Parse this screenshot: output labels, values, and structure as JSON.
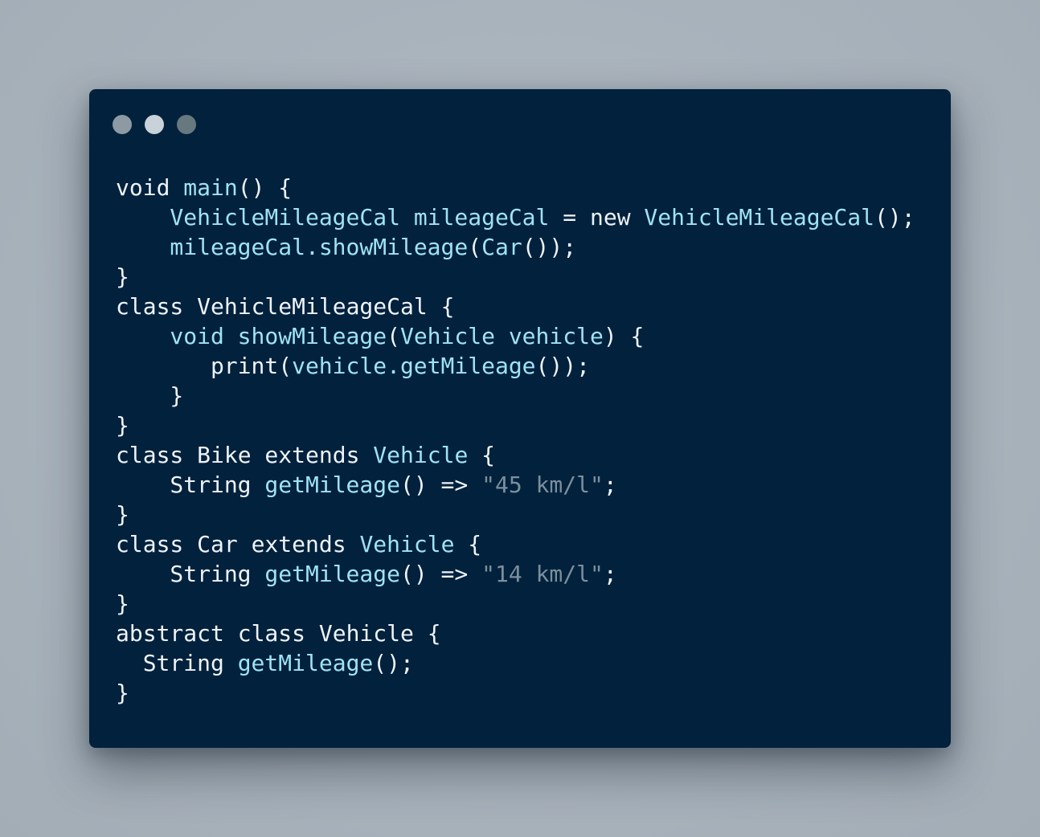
{
  "window": {
    "control_colors": [
      "#8d9aa3",
      "#c9d2d8",
      "#67787f"
    ],
    "control_icons": [
      "window-dot-icon",
      "window-dot-icon",
      "window-dot-icon"
    ]
  },
  "code": {
    "colors": {
      "background": "#01213d",
      "default": "#eef3f7",
      "ident": "#9fe3f4",
      "string": "#7b8f9c"
    },
    "lines": [
      {
        "indent": "",
        "tokens": [
          [
            "default",
            "void "
          ],
          [
            "ident",
            "main"
          ],
          [
            "default",
            "() {"
          ]
        ]
      },
      {
        "indent": "    ",
        "tokens": [
          [
            "ident",
            "VehicleMileageCal mileageCal"
          ],
          [
            "default",
            " = "
          ],
          [
            "default",
            "new "
          ],
          [
            "ident",
            "VehicleMileageCal"
          ],
          [
            "default",
            "();"
          ]
        ]
      },
      {
        "indent": "    ",
        "tokens": [
          [
            "ident",
            "mileageCal.showMileage"
          ],
          [
            "default",
            "("
          ],
          [
            "ident",
            "Car"
          ],
          [
            "default",
            "());"
          ]
        ]
      },
      {
        "indent": "",
        "tokens": [
          [
            "default",
            "}"
          ]
        ]
      },
      {
        "indent": "",
        "tokens": [
          [
            "default",
            "class VehicleMileageCal {"
          ]
        ]
      },
      {
        "indent": "    ",
        "tokens": [
          [
            "ident",
            "void showMileage"
          ],
          [
            "default",
            "("
          ],
          [
            "ident",
            "Vehicle vehicle"
          ],
          [
            "default",
            ") {"
          ]
        ]
      },
      {
        "indent": "       ",
        "tokens": [
          [
            "default",
            "print("
          ],
          [
            "ident",
            "vehicle.getMileage"
          ],
          [
            "default",
            "());"
          ]
        ]
      },
      {
        "indent": "    ",
        "tokens": [
          [
            "default",
            "}"
          ]
        ]
      },
      {
        "indent": "",
        "tokens": [
          [
            "default",
            "}"
          ]
        ]
      },
      {
        "indent": "",
        "tokens": [
          [
            "default",
            "class Bike extends "
          ],
          [
            "ident",
            "Vehicle"
          ],
          [
            "default",
            " {"
          ]
        ]
      },
      {
        "indent": "    ",
        "tokens": [
          [
            "default",
            "String "
          ],
          [
            "ident",
            "getMileage"
          ],
          [
            "default",
            "() => "
          ],
          [
            "string",
            "\"45 km/l\""
          ],
          [
            "default",
            ";"
          ]
        ]
      },
      {
        "indent": "",
        "tokens": [
          [
            "default",
            "}"
          ]
        ]
      },
      {
        "indent": "",
        "tokens": [
          [
            "default",
            "class Car extends "
          ],
          [
            "ident",
            "Vehicle"
          ],
          [
            "default",
            " {"
          ]
        ]
      },
      {
        "indent": "    ",
        "tokens": [
          [
            "default",
            "String "
          ],
          [
            "ident",
            "getMileage"
          ],
          [
            "default",
            "() => "
          ],
          [
            "string",
            "\"14 km/l\""
          ],
          [
            "default",
            ";"
          ]
        ]
      },
      {
        "indent": "",
        "tokens": [
          [
            "default",
            "}"
          ]
        ]
      },
      {
        "indent": "",
        "tokens": [
          [
            "default",
            "abstract class Vehicle {"
          ]
        ]
      },
      {
        "indent": "  ",
        "tokens": [
          [
            "default",
            "String "
          ],
          [
            "ident",
            "getMileage"
          ],
          [
            "default",
            "();"
          ]
        ]
      },
      {
        "indent": "",
        "tokens": [
          [
            "default",
            "}"
          ]
        ]
      }
    ]
  }
}
